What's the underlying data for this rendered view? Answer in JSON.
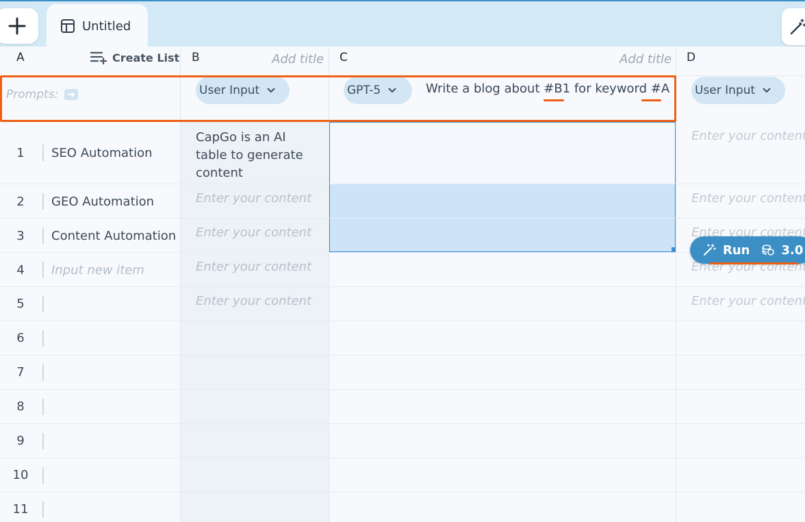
{
  "tabs": [
    {
      "label": "Untitled"
    }
  ],
  "columns": {
    "a": {
      "letter": "A",
      "create_list": "Create List"
    },
    "b": {
      "letter": "B",
      "add_title": "Add title"
    },
    "c": {
      "letter": "C",
      "add_title": "Add title"
    },
    "d": {
      "letter": "D"
    }
  },
  "prompt_row": {
    "label": "Prompts:",
    "b_type": "User Input",
    "c_model": "GPT-5",
    "c_prompt": "Write a blog about #B1 for keyword #A",
    "d_type": "User Input"
  },
  "rows": [
    {
      "num": "1",
      "a": "SEO Automation",
      "b": "CapGo is an AI table to generate content",
      "d": "Enter your content"
    },
    {
      "num": "2",
      "a": "GEO Automation",
      "b": "Enter your content",
      "d": "Enter your content"
    },
    {
      "num": "3",
      "a": "Content Automation",
      "b": "Enter your content",
      "d": "Enter your content"
    },
    {
      "num": "4",
      "a": "Input new item",
      "b": "Enter your content",
      "d": "Enter your content"
    },
    {
      "num": "5",
      "a": "",
      "b": "Enter your content",
      "d": "Enter your content"
    },
    {
      "num": "6"
    },
    {
      "num": "7"
    },
    {
      "num": "8"
    },
    {
      "num": "9"
    },
    {
      "num": "10"
    },
    {
      "num": "11"
    }
  ],
  "run_button": {
    "label": "Run",
    "cost": "3.0"
  },
  "colors": {
    "accent": "#3c8fc4",
    "highlight": "#ee5f12",
    "selection": "#cde3f8"
  }
}
